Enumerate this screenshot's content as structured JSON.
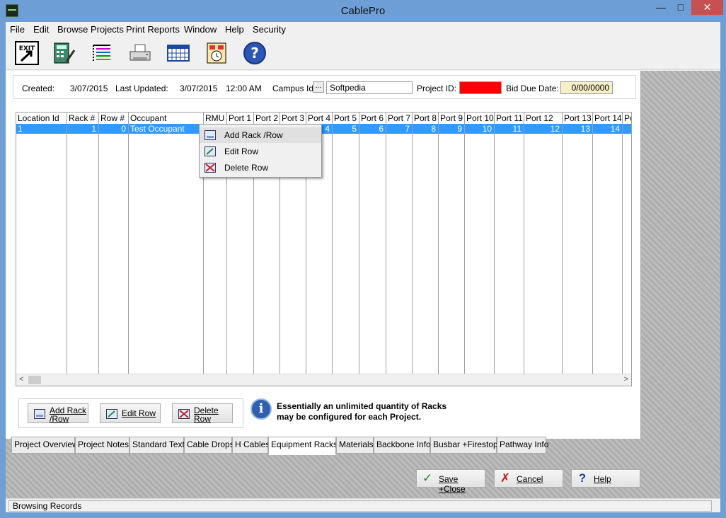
{
  "window": {
    "title": "CablePro",
    "minimize": "—",
    "maximize": "□",
    "close": "✕"
  },
  "menu": [
    "File",
    "Edit",
    "Browse Projects",
    "Print Reports",
    "Window",
    "Help",
    "Security"
  ],
  "toolbar": {
    "exit_label": "EXIT",
    "icons": [
      "exit-icon",
      "calculator-icon",
      "list-icon",
      "printer-icon",
      "calendar-icon",
      "schedule-icon",
      "help-icon"
    ],
    "help_glyph": "?"
  },
  "project": {
    "created_label": "Created:",
    "created_value": "3/07/2015",
    "updated_label": "Last Updated:",
    "updated_date": "3/07/2015",
    "updated_time": "12:00 AM",
    "campus_label": "Campus Id:",
    "campus_button": "...",
    "campus_value": "Softpedia",
    "project_id_label": "Project ID:",
    "project_id_value": "",
    "bid_due_label": "Bid Due Date:",
    "bid_due_value": "0/00/0000",
    "project_id_color": "#ff0000"
  },
  "grid": {
    "columns": [
      "Location Id",
      "Rack #",
      "Row #",
      "Occupant",
      "RMU",
      "Port 1",
      "Port 2",
      "Port 3",
      "Port 4",
      "Port 5",
      "Port 6",
      "Port 7",
      "Port 8",
      "Port 9",
      "Port 10",
      "Port 11",
      "Port 12",
      "Port 13",
      "Port 14",
      "Po"
    ],
    "row": [
      "1",
      "1",
      "0",
      "Test Occupant",
      "",
      "",
      "",
      "",
      "4",
      "5",
      "6",
      "7",
      "8",
      "9",
      "10",
      "11",
      "12",
      "13",
      "14",
      ""
    ],
    "scroll_left": "<",
    "scroll_right": ">"
  },
  "context_menu": [
    "Add Rack /Row",
    "Edit Row",
    "Delete Row"
  ],
  "actions": {
    "add_line1": "Add Rack",
    "add_line2": "/Row",
    "edit": "Edit Row",
    "delete_line1": "Delete",
    "delete_line2": "Row"
  },
  "info": {
    "glyph": "i",
    "line1": "Essentially an unlimited quantity of Racks",
    "line2": "may be configured for each Project."
  },
  "tabs": [
    "Project Overview",
    "Project Notes:",
    "Standard Text",
    "Cable Drops",
    "H Cables",
    "Equipment Racks",
    "Materials",
    "Backbone Info",
    "Busbar +Firestops",
    "Pathway Info"
  ],
  "active_tab": "Equipment Racks",
  "bottom_buttons": {
    "save": "Save +Close",
    "cancel": "Cancel",
    "help": "Help",
    "save_icon": "✓",
    "cancel_icon": "✗",
    "help_icon": "?"
  },
  "status": "Browsing Records",
  "colors": {
    "selection": "#3399ff",
    "titlebar": "#6d9ed6",
    "close": "#c75050"
  }
}
